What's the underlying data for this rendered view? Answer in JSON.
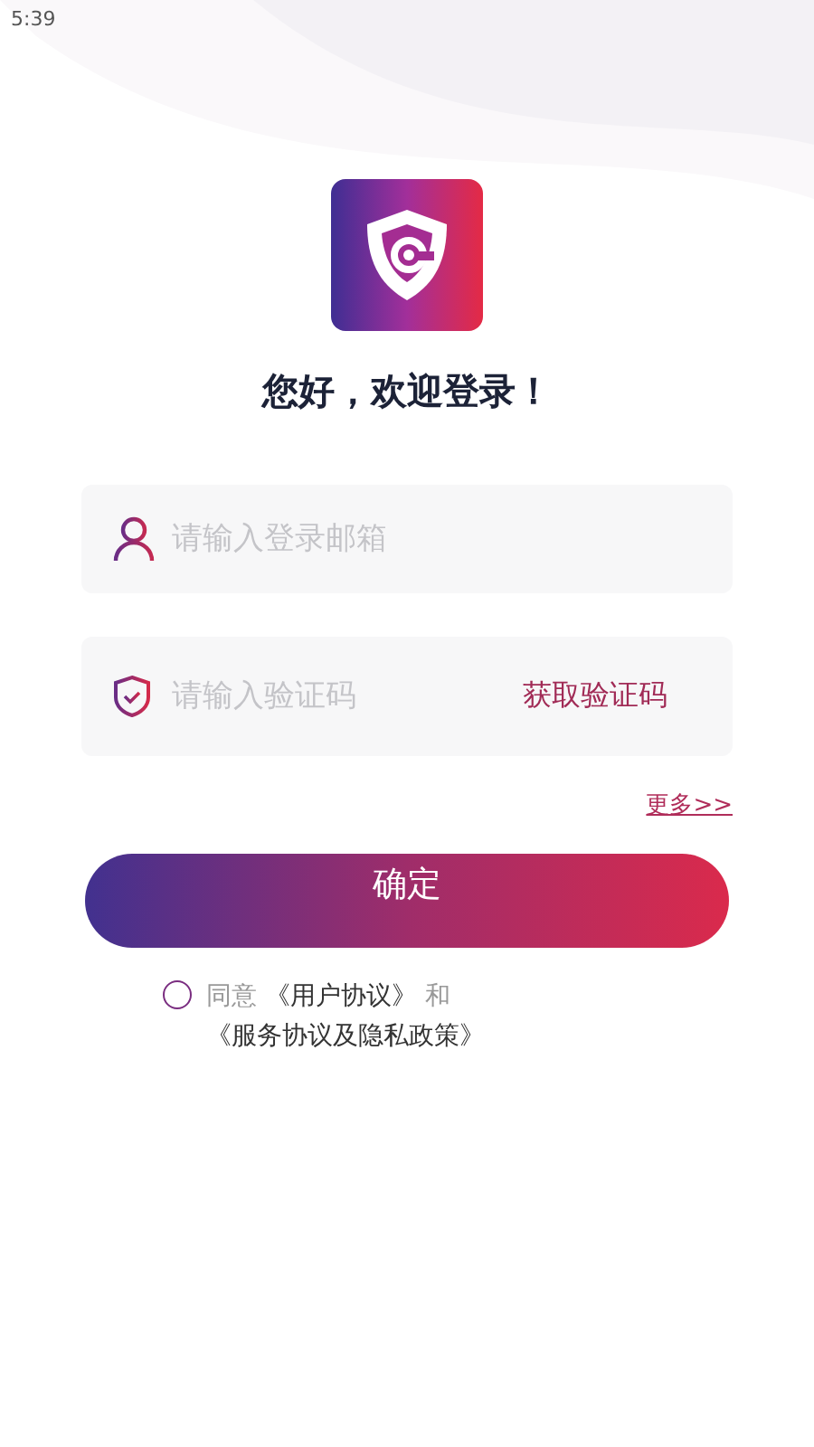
{
  "status_bar": {
    "time": "5:39"
  },
  "greeting": "您好，欢迎登录！",
  "fields": [
    {
      "kind": "email",
      "placeholder": "请输入登录邮箱"
    },
    {
      "kind": "code",
      "placeholder": "请输入验证码",
      "action": "获取验证码"
    }
  ],
  "more_link": "更多>>",
  "submit_button": "确定",
  "agreement": {
    "checked": false,
    "parts": [
      {
        "kind": "text",
        "text": "同意 "
      },
      {
        "kind": "link",
        "text": "《用户协议》"
      },
      {
        "kind": "text",
        "text": " 和 "
      },
      {
        "kind": "link",
        "text": "《服务协议及隐私政策》"
      }
    ]
  }
}
